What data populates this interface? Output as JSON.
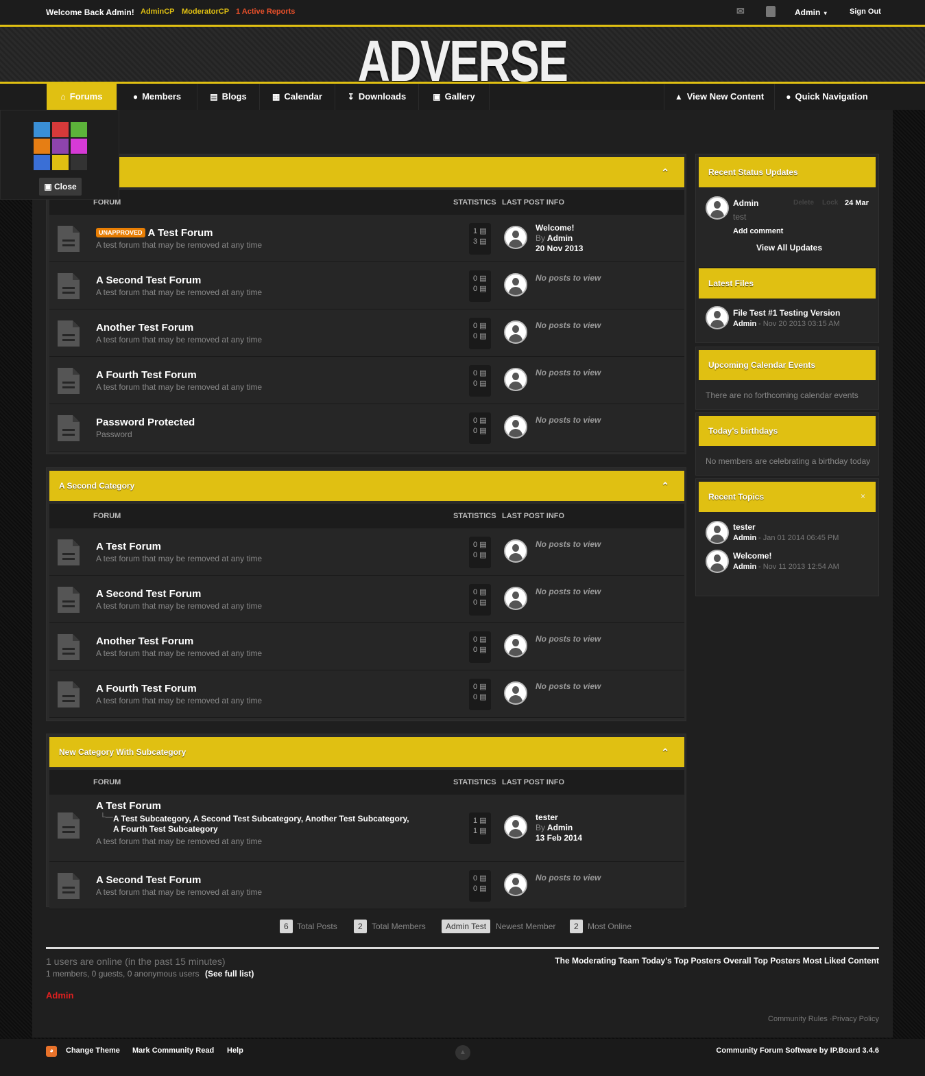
{
  "topbar": {
    "welcome": "Welcome Back Admin!",
    "admincp": "AdminCP",
    "modcp": "ModeratorCP",
    "reports": "1 Active Reports",
    "user": "Admin",
    "signout": "Sign Out"
  },
  "logo": "ADVERSE",
  "nav": {
    "forums": "Forums",
    "members": "Members",
    "blogs": "Blogs",
    "calendar": "Calendar",
    "downloads": "Downloads",
    "gallery": "Gallery",
    "view_new": "View New Content",
    "quick_nav": "Quick Navigation"
  },
  "swatch": {
    "close": "Close",
    "colors": [
      "#3a8fd6",
      "#d63a3a",
      "#5cb33a",
      "#e67e14",
      "#8e44ad",
      "#d63ad6",
      "#3a6fd6",
      "#e0c012",
      "#333333"
    ]
  },
  "columns": {
    "forum": "FORUM",
    "statistics": "STATISTICS",
    "last_post": "LAST POST INFO"
  },
  "cat1": {
    "title": "",
    "rows": [
      {
        "name": "A Test Forum",
        "badge": "UNAPPROVED",
        "desc": "A test forum that may be removed at any time",
        "s1": "1",
        "s2": "3",
        "lp_title": "Welcome!",
        "lp_by": "By",
        "lp_user": "Admin",
        "lp_date": "20 Nov 2013"
      },
      {
        "name": "A Second Test Forum",
        "desc": "A test forum that may be removed at any time",
        "s1": "0",
        "s2": "0",
        "nop": "No posts to view"
      },
      {
        "name": "Another Test Forum",
        "desc": "A test forum that may be removed at any time",
        "s1": "0",
        "s2": "0",
        "nop": "No posts to view"
      },
      {
        "name": "A Fourth Test Forum",
        "desc": "A test forum that may be removed at any time",
        "s1": "0",
        "s2": "0",
        "nop": "No posts to view"
      },
      {
        "name": "Password Protected",
        "desc": "Password",
        "s1": "0",
        "s2": "0",
        "nop": "No posts to view"
      }
    ]
  },
  "cat2": {
    "title": "A Second Category",
    "rows": [
      {
        "name": "A Test Forum",
        "desc": "A test forum that may be removed at any time",
        "s1": "0",
        "s2": "0",
        "nop": "No posts to view"
      },
      {
        "name": "A Second Test Forum",
        "desc": "A test forum that may be removed at any time",
        "s1": "0",
        "s2": "0",
        "nop": "No posts to view"
      },
      {
        "name": "Another Test Forum",
        "desc": "A test forum that may be removed at any time",
        "s1": "0",
        "s2": "0",
        "nop": "No posts to view"
      },
      {
        "name": "A Fourth Test Forum",
        "desc": "A test forum that may be removed at any time",
        "s1": "0",
        "s2": "0",
        "nop": "No posts to view"
      }
    ]
  },
  "cat3": {
    "title": "New Category With Subcategory",
    "rows": [
      {
        "name": "A Test Forum",
        "subs": "A Test Subcategory, A Second Test Subcategory, Another Test Subcategory,",
        "subs2": "A Fourth Test Subcategory",
        "desc": "A test forum that may be removed at any time",
        "s1": "1",
        "s2": "1",
        "lp_title": "tester",
        "lp_by": "By",
        "lp_user": "Admin",
        "lp_date": "13 Feb 2014"
      },
      {
        "name": "A Second Test Forum",
        "desc": "A test forum that may be removed at any time",
        "s1": "0",
        "s2": "0",
        "nop": "No posts to view"
      }
    ]
  },
  "sidebar": {
    "status": {
      "title": "Recent Status Updates",
      "user": "Admin",
      "delete": "Delete",
      "lock": "Lock",
      "date": "24 Mar",
      "text": "test",
      "add": "Add comment",
      "view_all": "View All Updates"
    },
    "files": {
      "title": "Latest Files",
      "name": "File Test #1 Testing Version",
      "user": "Admin",
      "date": "- Nov 20 2013 03:15 AM"
    },
    "calendar": {
      "title": "Upcoming Calendar Events",
      "text": "There are no forthcoming calendar events"
    },
    "birthdays": {
      "title": "Today's birthdays",
      "text": "No members are celebrating a birthday today"
    },
    "topics": {
      "title": "Recent Topics",
      "close": "×",
      "items": [
        {
          "title": "tester",
          "user": "Admin",
          "date": "- Jan 01 2014 06:45 PM"
        },
        {
          "title": "Welcome!",
          "user": "Admin",
          "date": "- Nov 11 2013 12:54 AM"
        }
      ]
    }
  },
  "stats": {
    "posts": "6",
    "posts_lbl": "Total Posts",
    "members": "2",
    "members_lbl": "Total Members",
    "newest": "Admin Test",
    "newest_lbl": "Newest Member",
    "online": "2",
    "online_lbl": "Most Online"
  },
  "online": {
    "title": "1 users are online (in the past 15 minutes)",
    "detail": "1 members, 0 guests, 0 anonymous users",
    "full": "(See full list)",
    "user": "Admin",
    "links": "The Moderating Team Today's Top Posters Overall Top Posters Most Liked Content"
  },
  "rules": "Community Rules ·Privacy Policy",
  "footer": {
    "theme": "Change Theme",
    "mark": "Mark Community Read",
    "help": "Help",
    "credit": "Community Forum Software by IP.Board 3.4.6"
  }
}
